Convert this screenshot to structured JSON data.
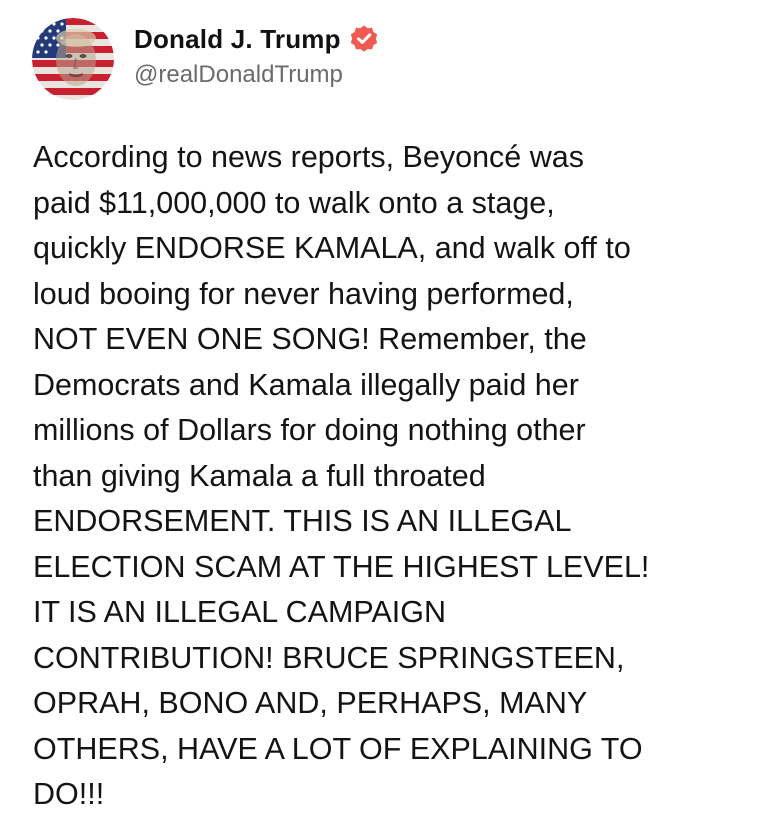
{
  "author": {
    "display_name": "Donald J. Trump",
    "handle": "@realDonaldTrump",
    "verified": true,
    "verified_color": "#f05a4f"
  },
  "post": {
    "text": "According to news reports, Beyoncé was\npaid $11,000,000 to walk onto a stage,\nquickly ENDORSE KAMALA, and walk off to\nloud booing for never having performed,\nNOT EVEN ONE SONG! Remember, the\nDemocrats and Kamala illegally paid her\nmillions of Dollars for doing nothing other\nthan giving Kamala a full throated\nENDORSEMENT. THIS IS AN ILLEGAL\nELECTION SCAM AT THE HIGHEST LEVEL!\nIT IS AN ILLEGAL CAMPAIGN\nCONTRIBUTION! BRUCE SPRINGSTEEN,\nOPRAH, BONO AND, PERHAPS, MANY\nOTHERS, HAVE A LOT OF EXPLAINING TO\nDO!!!"
  },
  "icons": {
    "avatar": "flag-portrait-avatar",
    "verified": "verified-badge-icon"
  },
  "colors": {
    "text": "#141414",
    "handle": "#6b6b6b",
    "background": "#ffffff"
  }
}
